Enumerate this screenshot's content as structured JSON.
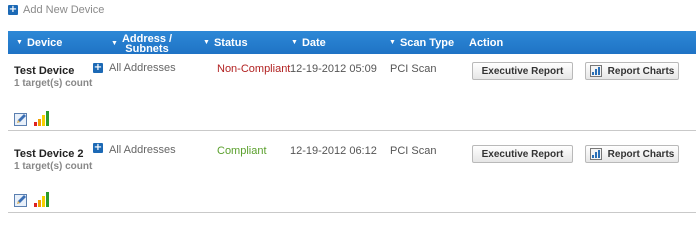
{
  "add_device": {
    "label": "Add New Device"
  },
  "table": {
    "columns": {
      "device": "Device",
      "address_line1": "Address /",
      "address_line2": "Subnets",
      "status": "Status",
      "date": "Date",
      "scan_type": "Scan Type",
      "action": "Action"
    },
    "rows": [
      {
        "name": "Test Device",
        "targets": "1 target(s) count",
        "address": "All Addresses",
        "status": "Non-Compliant",
        "status_color": "#b22222",
        "date": "12-19-2012 05:09",
        "scan_type": "PCI Scan",
        "exec_report": "Executive Report",
        "report_charts": "Report Charts"
      },
      {
        "name": "Test Device 2",
        "targets": "1 target(s) count",
        "address": "All Addresses",
        "status": "Compliant",
        "status_color": "#5aa02c",
        "date": "12-19-2012 06:12",
        "scan_type": "PCI Scan",
        "exec_report": "Executive Report",
        "report_charts": "Report Charts"
      }
    ]
  },
  "colors": {
    "header": "#1f73c5",
    "accent": "#1c69b5"
  }
}
